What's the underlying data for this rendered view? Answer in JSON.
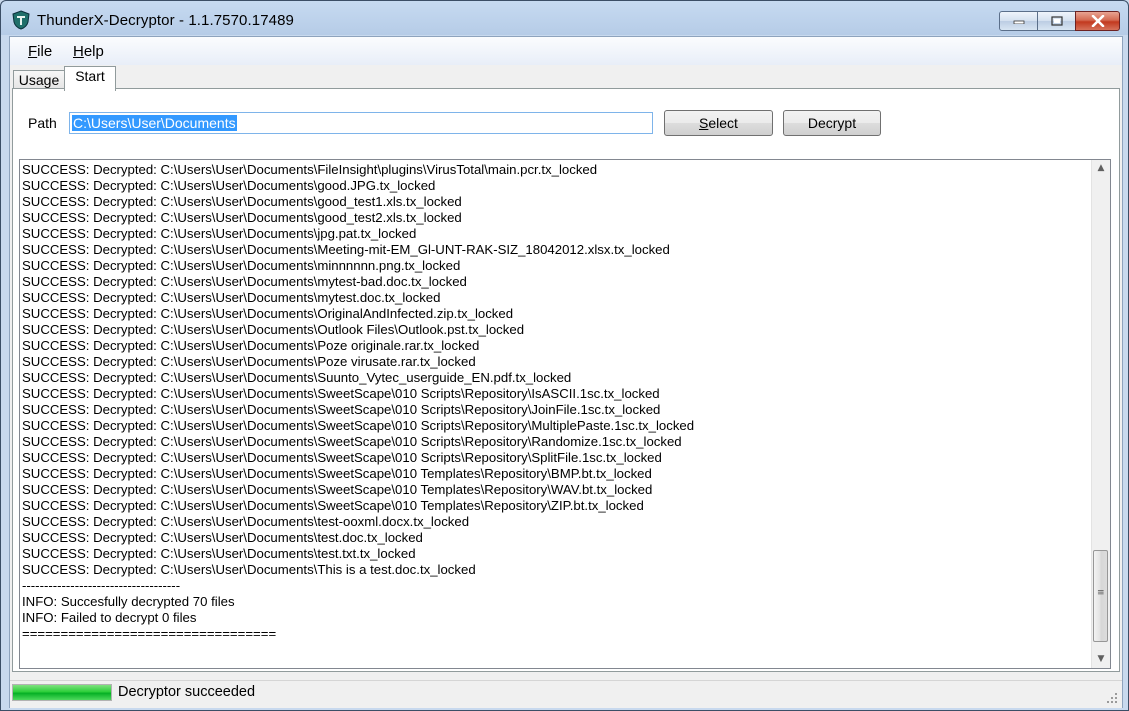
{
  "window": {
    "title": "ThunderX-Decryptor - 1.1.7570.17489",
    "controls": [
      "minimize-icon",
      "maximize-icon",
      "close-icon"
    ]
  },
  "menu": {
    "file_acc": "F",
    "file_rest": "ile",
    "help_acc": "H",
    "help_rest": "elp"
  },
  "tabs": {
    "usage": "Usage",
    "start": "Start",
    "active": "Start"
  },
  "form": {
    "path_label": "Path",
    "path_value": "C:\\Users\\User\\Documents",
    "select_acc": "S",
    "select_rest": "elect",
    "decrypt_label": "Decrypt"
  },
  "log": [
    "SUCCESS: Decrypted: C:\\Users\\User\\Documents\\FileInsight\\plugins\\VirusTotal\\main.pcr.tx_locked",
    "SUCCESS: Decrypted: C:\\Users\\User\\Documents\\good.JPG.tx_locked",
    "SUCCESS: Decrypted: C:\\Users\\User\\Documents\\good_test1.xls.tx_locked",
    "SUCCESS: Decrypted: C:\\Users\\User\\Documents\\good_test2.xls.tx_locked",
    "SUCCESS: Decrypted: C:\\Users\\User\\Documents\\jpg.pat.tx_locked",
    "SUCCESS: Decrypted: C:\\Users\\User\\Documents\\Meeting-mit-EM_Gl-UNT-RAK-SIZ_18042012.xlsx.tx_locked",
    "SUCCESS: Decrypted: C:\\Users\\User\\Documents\\minnnnnn.png.tx_locked",
    "SUCCESS: Decrypted: C:\\Users\\User\\Documents\\mytest-bad.doc.tx_locked",
    "SUCCESS: Decrypted: C:\\Users\\User\\Documents\\mytest.doc.tx_locked",
    "SUCCESS: Decrypted: C:\\Users\\User\\Documents\\OriginalAndInfected.zip.tx_locked",
    "SUCCESS: Decrypted: C:\\Users\\User\\Documents\\Outlook Files\\Outlook.pst.tx_locked",
    "SUCCESS: Decrypted: C:\\Users\\User\\Documents\\Poze originale.rar.tx_locked",
    "SUCCESS: Decrypted: C:\\Users\\User\\Documents\\Poze virusate.rar.tx_locked",
    "SUCCESS: Decrypted: C:\\Users\\User\\Documents\\Suunto_Vytec_userguide_EN.pdf.tx_locked",
    "SUCCESS: Decrypted: C:\\Users\\User\\Documents\\SweetScape\\010 Scripts\\Repository\\IsASCII.1sc.tx_locked",
    "SUCCESS: Decrypted: C:\\Users\\User\\Documents\\SweetScape\\010 Scripts\\Repository\\JoinFile.1sc.tx_locked",
    "SUCCESS: Decrypted: C:\\Users\\User\\Documents\\SweetScape\\010 Scripts\\Repository\\MultiplePaste.1sc.tx_locked",
    "SUCCESS: Decrypted: C:\\Users\\User\\Documents\\SweetScape\\010 Scripts\\Repository\\Randomize.1sc.tx_locked",
    "SUCCESS: Decrypted: C:\\Users\\User\\Documents\\SweetScape\\010 Scripts\\Repository\\SplitFile.1sc.tx_locked",
    "SUCCESS: Decrypted: C:\\Users\\User\\Documents\\SweetScape\\010 Templates\\Repository\\BMP.bt.tx_locked",
    "SUCCESS: Decrypted: C:\\Users\\User\\Documents\\SweetScape\\010 Templates\\Repository\\WAV.bt.tx_locked",
    "SUCCESS: Decrypted: C:\\Users\\User\\Documents\\SweetScape\\010 Templates\\Repository\\ZIP.bt.tx_locked",
    "SUCCESS: Decrypted: C:\\Users\\User\\Documents\\test-ooxml.docx.tx_locked",
    "SUCCESS: Decrypted: C:\\Users\\User\\Documents\\test.doc.tx_locked",
    "SUCCESS: Decrypted: C:\\Users\\User\\Documents\\test.txt.tx_locked",
    "SUCCESS: Decrypted: C:\\Users\\User\\Documents\\This is a test.doc.tx_locked",
    "------------------------------------",
    "INFO: Succesfully decrypted 70 files",
    "INFO: Failed to decrypt 0 files",
    "================================="
  ],
  "status": {
    "text": "Decryptor succeeded",
    "progress_percent": 100,
    "progress_color": "#06b025"
  },
  "colors": {
    "selection": "#3399ff",
    "title_bar": "#b6cce7"
  }
}
